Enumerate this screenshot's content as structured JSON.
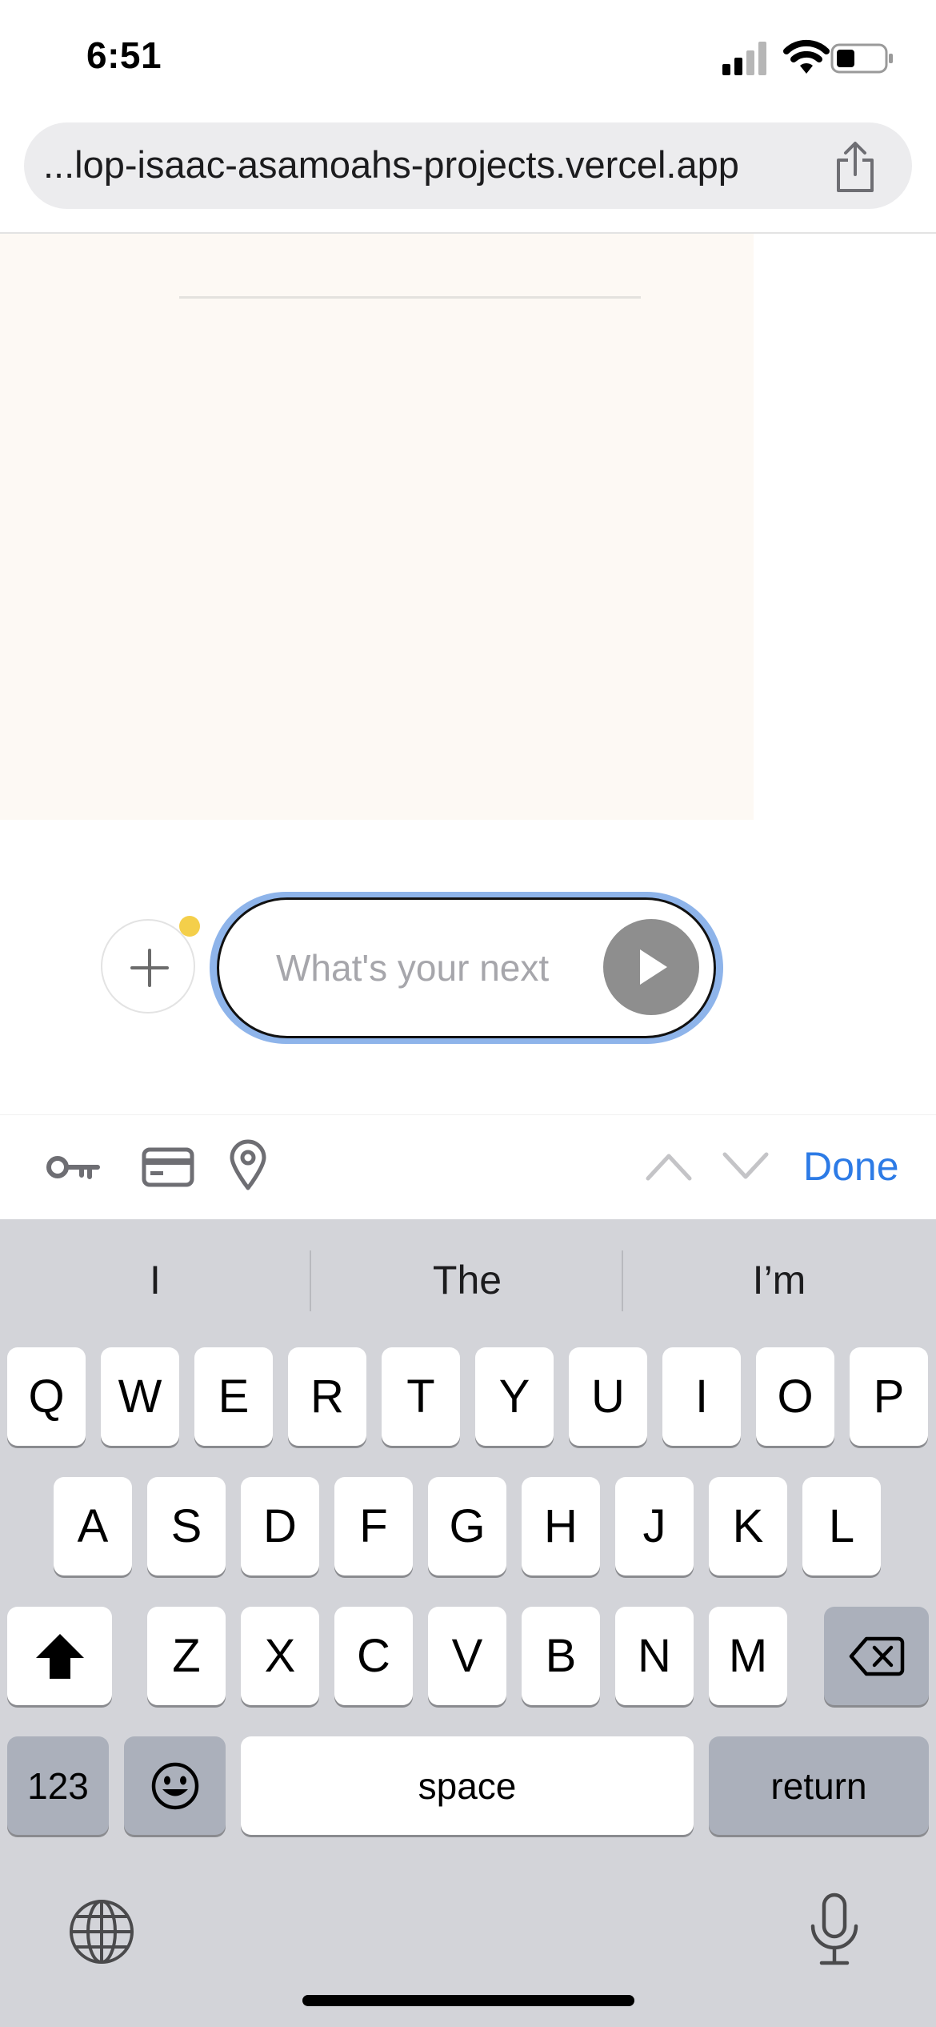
{
  "status_bar": {
    "time": "6:51"
  },
  "browser": {
    "url": "...lop-isaac-asamoahs-projects.vercel.app"
  },
  "composer": {
    "placeholder": "What's your next"
  },
  "accessory_bar": {
    "done_label": "Done"
  },
  "keyboard": {
    "suggestions": [
      "I",
      "The",
      "I’m"
    ],
    "row1": [
      "Q",
      "W",
      "E",
      "R",
      "T",
      "Y",
      "U",
      "I",
      "O",
      "P"
    ],
    "row2": [
      "A",
      "S",
      "D",
      "F",
      "G",
      "H",
      "J",
      "K",
      "L"
    ],
    "row3": [
      "Z",
      "X",
      "C",
      "V",
      "B",
      "N",
      "M"
    ],
    "numbers_label": "123",
    "space_label": "space",
    "return_label": "return"
  },
  "colors": {
    "accent": "#2d7be6",
    "focus_ring": "#8eb4ea",
    "badge": "#f4cf4a",
    "panel_background": "#fdf9f4"
  }
}
